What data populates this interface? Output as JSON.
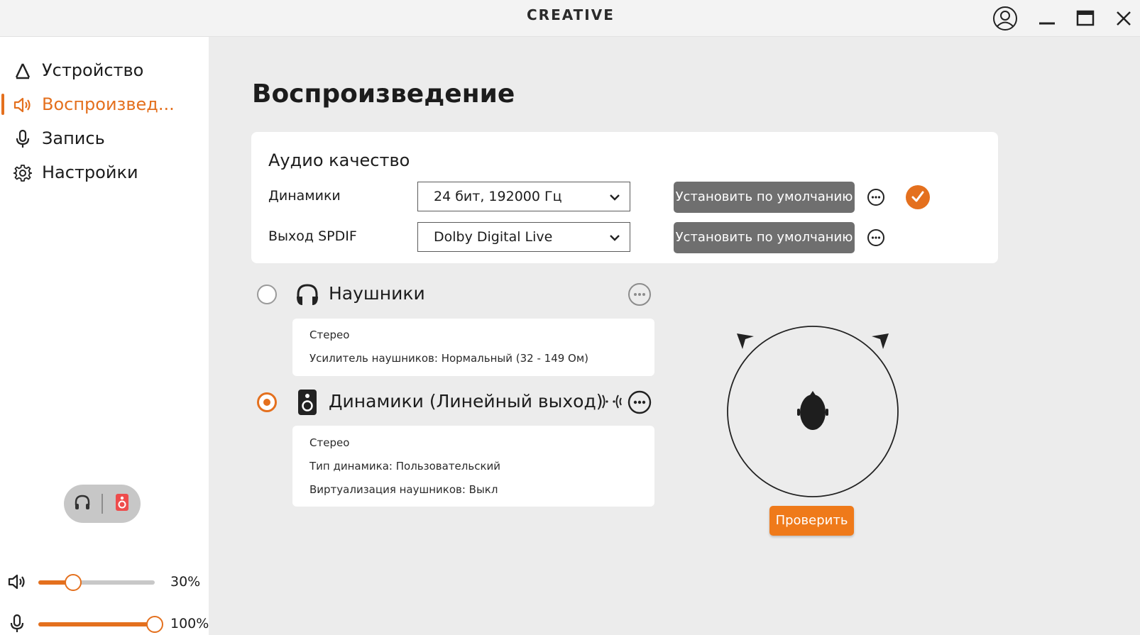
{
  "window": {
    "brand": "CREATIVE",
    "accent_color": "#e4701e",
    "controls": [
      "account-icon",
      "minimize-icon",
      "maximize-icon",
      "close-icon"
    ]
  },
  "sidebar": {
    "items": [
      {
        "label": "Устройство",
        "icon": "device-icon"
      },
      {
        "label": "Воспроизвед...",
        "icon": "speaker-icon",
        "active": true
      },
      {
        "label": "Запись",
        "icon": "microphone-icon"
      },
      {
        "label": "Настройки",
        "icon": "gear-icon"
      }
    ],
    "output_toggle": {
      "options": [
        "headphones-icon",
        "speaker-box-icon"
      ],
      "selected": "speaker-box-icon"
    },
    "volume": {
      "label": "30%",
      "value": 0.3,
      "icon": "speaker-icon"
    },
    "mic": {
      "label": "100%",
      "value": 1.0,
      "icon": "microphone-icon"
    }
  },
  "main": {
    "title": "Воспроизведение",
    "audio_quality": {
      "title": "Аудио качество",
      "rows": [
        {
          "label": "Динамики",
          "value": "24 бит, 192000 Гц",
          "button": "Установить по умолчанию",
          "checked": true
        },
        {
          "label": "Выход SPDIF",
          "value": "Dolby Digital Live",
          "button": "Установить по умолчанию",
          "checked": false
        }
      ]
    },
    "devices": [
      {
        "name": "Наушники",
        "selected": false,
        "icon": "headphones-icon",
        "details": [
          {
            "text": "Стерео"
          },
          {
            "text": "Усилитель наушников:  Нормальный (32 - 149 Ом)"
          }
        ]
      },
      {
        "name": "Динамики (Линейный выход)",
        "selected": true,
        "icon": "speaker-box-icon",
        "details": [
          {
            "text": "Стерео"
          },
          {
            "text": "Тип динамика:  Пользовательский"
          },
          {
            "text": "Виртуализация наушников:  Выкл"
          }
        ]
      }
    ],
    "test_button": "Проверить"
  }
}
